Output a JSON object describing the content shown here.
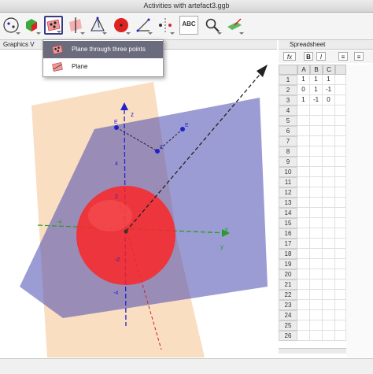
{
  "window": {
    "title": "Activities with artefact3.ggb"
  },
  "toolbar": {
    "tools": [
      {
        "icon": "move-icon",
        "selected": false
      },
      {
        "icon": "point-icon",
        "selected": false
      },
      {
        "icon": "plane-three-points-icon",
        "selected": true
      },
      {
        "icon": "perpendicular-line-icon",
        "selected": false
      },
      {
        "icon": "pyramid-icon",
        "selected": false
      },
      {
        "icon": "sphere-icon",
        "selected": false
      },
      {
        "icon": "angle-icon",
        "selected": false
      },
      {
        "icon": "reflect-icon",
        "selected": false
      },
      {
        "icon": "text-icon",
        "label": "ABC",
        "selected": false
      },
      {
        "icon": "zoom-icon",
        "selected": false
      },
      {
        "icon": "rotate-view-icon",
        "selected": false
      }
    ]
  },
  "graphics_panel": {
    "title": "Graphics V",
    "axis_labels": {
      "z": "z",
      "y": "y"
    },
    "ticks": [
      "4",
      "2",
      "-2",
      "-4",
      "-4",
      "6"
    ],
    "point_labels": [
      "E",
      "E",
      "C"
    ]
  },
  "tool_menu": {
    "items": [
      {
        "label": "Plane through three points",
        "highlighted": true
      },
      {
        "label": "Plane",
        "highlighted": false
      }
    ]
  },
  "spreadsheet": {
    "title": "Spreadsheet",
    "toolbar": {
      "fx": "fx",
      "bold": "B",
      "italic": "I"
    },
    "columns": [
      "A",
      "B",
      "C"
    ],
    "row_numbers": [
      "1",
      "2",
      "3",
      "4",
      "5",
      "6",
      "7",
      "8",
      "9",
      "10",
      "11",
      "12",
      "13",
      "14",
      "15",
      "16",
      "17",
      "18",
      "19",
      "20",
      "21",
      "22",
      "23",
      "24",
      "25",
      "26"
    ],
    "rows": [
      [
        "1",
        "1",
        "1"
      ],
      [
        "0",
        "1",
        "-1"
      ],
      [
        "1",
        "-1",
        "0"
      ]
    ]
  },
  "colors": {
    "plane_orange": "#f5c89a",
    "plane_blue": "#4a4ab0",
    "sphere_red": "#ff2222",
    "axis_green": "#2a9a2a",
    "axis_blue": "#2222cc",
    "menu_highlight": "#6b6b7e"
  }
}
